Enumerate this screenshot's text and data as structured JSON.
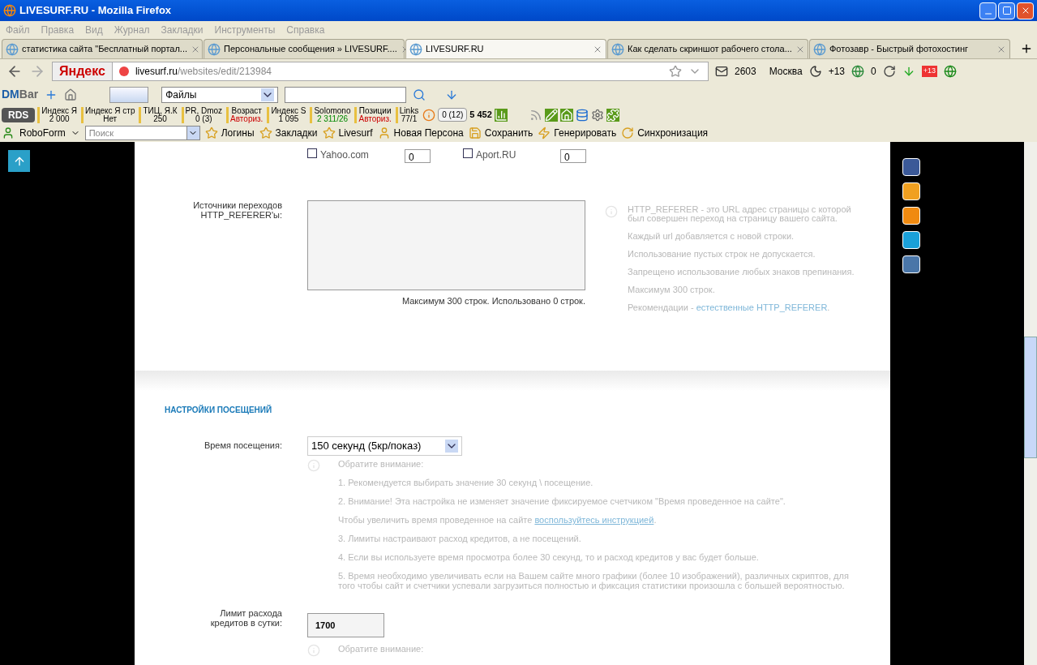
{
  "window": {
    "title": "LIVESURF.RU - Mozilla Firefox"
  },
  "menu": [
    "Файл",
    "Правка",
    "Вид",
    "Журнал",
    "Закладки",
    "Инструменты",
    "Справка"
  ],
  "tabs": [
    {
      "label": "статистика сайта \"Бесплатный портал...",
      "selected": false
    },
    {
      "label": "Персональные сообщения » LIVESURF....",
      "selected": false
    },
    {
      "label": "LIVESURF.RU",
      "selected": true
    },
    {
      "label": "Как сделать скриншот рабочего стола...",
      "selected": false
    },
    {
      "label": "Фотозавр - Быстрый фотохостинг",
      "selected": false
    }
  ],
  "nav": {
    "search_brand": "Яндекс",
    "url_host": "livesurf.ru",
    "url_path": "/websites/edit/213984",
    "mail_count": "2603",
    "city": "Москва",
    "temperature": "+13",
    "counter": "0",
    "badge": "+13"
  },
  "dmbar": {
    "logo_dm": "DM",
    "logo_bar": "Bar",
    "select_value": "Файлы"
  },
  "rds": {
    "logo": "RDS",
    "metrics": [
      {
        "label": "Индекс Я",
        "value": "2 000"
      },
      {
        "label": "Индекс Я стр",
        "value": "Нет"
      },
      {
        "label": "ТИЦ, Я.К",
        "value": "250"
      },
      {
        "label": "PR, Dmoz",
        "value": "0 (3)"
      },
      {
        "label": "Возраст",
        "value": "Авториз.",
        "color": "#cc0000"
      },
      {
        "label": "Индекс S",
        "value": "1 095"
      },
      {
        "label": "Solomono",
        "value": "2 311/26",
        "color": "#008800"
      },
      {
        "label": "Позиции",
        "value": "Авториз.",
        "color": "#cc0000"
      },
      {
        "label": "Links",
        "value": "77/1"
      }
    ],
    "gplus": "0 (12)",
    "score": "5 452"
  },
  "roboform": {
    "logo": "RoboForm",
    "search_placeholder": "Поиск",
    "items": [
      "Логины",
      "Закладки",
      "Livesurf",
      "Новая Персона",
      "Сохранить",
      "Генерировать",
      "Синхронизация"
    ]
  },
  "engines": [
    {
      "label": "Yahoo.com",
      "checked": false,
      "value": "0"
    },
    {
      "label": "Aport.RU",
      "checked": false,
      "value": "0"
    }
  ],
  "referer": {
    "label": "Источники переходов HTTP_REFERER'ы:",
    "counter": "Максимум 300 строк. Использовано 0 строк.",
    "help": [
      "HTTP_REFERER - это URL адрес страницы с которой был совершен переход на страницу вашего сайта.",
      "Каждый url добавляется с новой строки.",
      "Использование пустых строк не допускается.",
      "Запрещено использование любых знаков препинания.",
      "Максимум 300 строк."
    ],
    "recommend": {
      "text": "Рекомендации - ",
      "link": "естественные HTTP_REFERER",
      "suffix": "."
    }
  },
  "section_title": "НАСТРОЙКИ ПОСЕЩЕНИЙ",
  "visit_time": {
    "label": "Время посещения:",
    "value": "150 секунд (5кр/показ)",
    "notes": [
      {
        "text": "Обратите внимание:"
      },
      {
        "text": "1. Рекомендуется выбирать значение 30 секунд \\ посещение."
      },
      {
        "text": "2. Внимание! Эта настройка не изменяет значение фиксируемое счетчиком \"Время проведенное на сайте\"."
      },
      {
        "text": "Чтобы увеличить время проведенное на сайте ",
        "link": "воспользуйтесь инструкцией",
        "suffix": "."
      },
      {
        "text": "3. Лимиты настраивают расход кредитов, а не посещений."
      },
      {
        "text": "4. Если вы используете время просмотра более 30 секунд, то и расход кредитов у вас будет больше."
      },
      {
        "text": "5. Время необходимо увеличивать если на Вашем сайте много графики (более 10 изображений), различных скриптов, для того чтобы сайт и счетчики успевали загрузиться полностью и фиксация статистики произошла с большей вероятностью."
      }
    ]
  },
  "limit": {
    "label": "Лимит расхода кредитов в сутки:",
    "value": "1700",
    "note": "Обратите внимание:"
  }
}
